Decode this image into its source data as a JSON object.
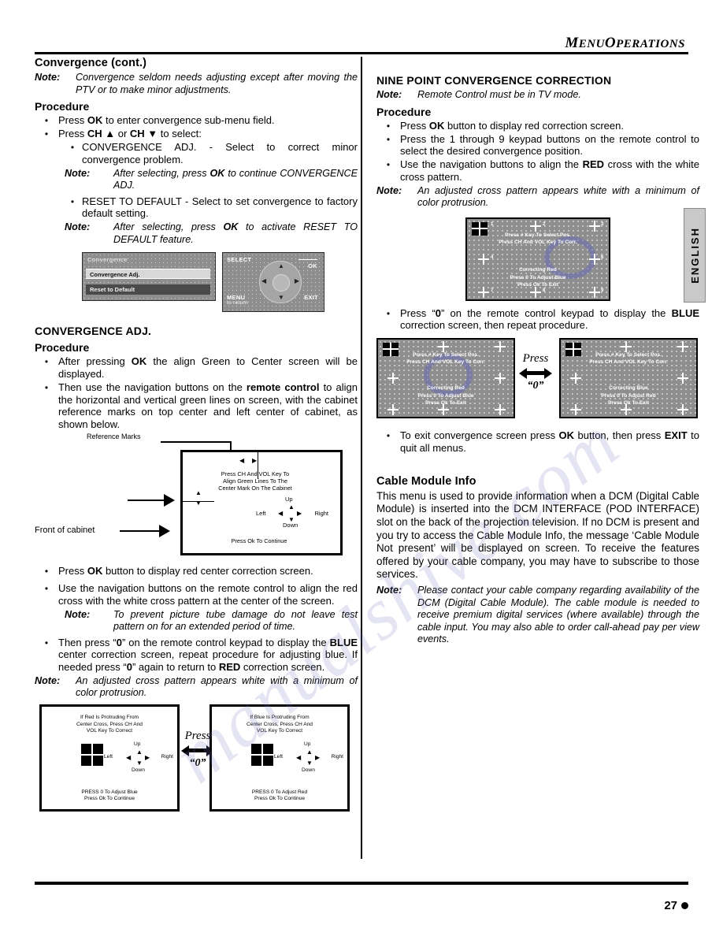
{
  "header": {
    "title_small": "ENU",
    "title_m1": "M",
    "title_m2": "O",
    "title_small2": "PERATIONS",
    "title_full": "MENU OPERATIONS"
  },
  "side_tab": {
    "label": "ENGLISH"
  },
  "footer": {
    "page_number": "27"
  },
  "left": {
    "heading": "Convergence (cont.)",
    "note1": {
      "label": "Note:",
      "text": "Convergence seldom needs adjusting except after moving the PTV or to make minor adjustments."
    },
    "procedure_label": "Procedure",
    "bullets": [
      {
        "pre": "Press ",
        "bold": "OK",
        "post": " to enter convergence  sub-menu field."
      },
      {
        "pre": "Press ",
        "bold": "CH ▲",
        "mid": " or ",
        "bold2": "CH ▼",
        "post": "  to select:"
      }
    ],
    "sub_bullet1": "CONVERGENCE ADJ. - Select to correct minor convergence problem.",
    "note2": {
      "label": "Note:",
      "text": "After selecting, press ",
      "bold": "OK",
      "text2": " to continue CONVERGENCE ADJ."
    },
    "sub_bullet2": "RESET TO DEFAULT - Select to set convergence to factory default setting.",
    "note3": {
      "label": "Note:",
      "text": "After selecting, press ",
      "bold": "OK",
      "text2": " to activate RESET TO DEFAULT feature."
    },
    "osd": {
      "title": "Convergence",
      "item_selected": "Convergence  Adj.",
      "item_second": "Reset to Default",
      "nav_select": "SELECT",
      "nav_ok": "OK",
      "nav_menu": "MENU",
      "nav_return": "to return",
      "nav_exit": "EXIT"
    },
    "heading2": "CONVERGENCE ADJ.",
    "procedure_label2": "Procedure",
    "bullets2": [
      {
        "pre": "After pressing ",
        "bold": "OK",
        "post": "  the align Green to Center screen will be displayed."
      },
      {
        "pre": "Then use the navigation buttons on the ",
        "bold": "remote control",
        "post": " to align the horizontal and vertical green lines on screen, with the cabinet reference marks on top center and left center of cabinet, as shown below."
      }
    ],
    "cabinet": {
      "label_reference": "Reference Marks",
      "label_front": "Front of cabinet",
      "instruction_line1": "Press CH And VOL Key To",
      "instruction_line2": "Align Green Lines To The",
      "instruction_line3": "Center Mark On The Cabinet",
      "continue": "Press Ok To Continue",
      "up": "Up",
      "down": "Down",
      "left": "Left",
      "right": "Right"
    },
    "bullets3": [
      {
        "pre": "Press ",
        "bold": "OK",
        "post": " button to display red center correction screen."
      },
      {
        "pre": "Use the navigation buttons on the remote control to align the red cross with the white cross pattern at the center of the screen.",
        "bold": "",
        "post": ""
      }
    ],
    "note4": {
      "label": "Note:",
      "text": "To prevent picture tube damage do not leave test pattern on for an extended period of time."
    },
    "bullet4": {
      "pre": "Then press “",
      "bold": "0",
      "mid": "” on the remote control keypad to display the ",
      "bold2": "BLUE",
      "mid2": " center correction screen, repeat procedure for adjusting blue. If needed press “",
      "bold3": "0",
      "mid3": "” again to return to ",
      "bold4": "RED",
      "post": " correction screen."
    },
    "note5": {
      "label": "Note:",
      "text": "An adjusted cross pattern appears white with a minimum of color protrusion."
    },
    "pair_left": {
      "top_line1": "If Red Is Protruding From",
      "top_line2": "Center Cross, Press CH And",
      "top_line3": "VOL Key To Correct",
      "bot_line1": "PRESS 0 To Adjust Blue",
      "bot_line2": "Press Ok To Continue",
      "up": "Up",
      "down": "Down",
      "left": "Left",
      "right": "Right"
    },
    "pair_right": {
      "top_line1": "If Blue Is Protruding From",
      "top_line2": "Center Cross, Press CH And",
      "top_line3": "VOL Key To Correct",
      "bot_line1": "PRESS 0 To Adjust Red",
      "bot_line2": "Press Ok To Continue",
      "up": "Up",
      "down": "Down",
      "left": "Left",
      "right": "Right"
    },
    "press_label": "Press",
    "press_zero": "“0”"
  },
  "right": {
    "heading": "NINE POINT CONVERGENCE CORRECTION",
    "note1": {
      "label": "Note:",
      "text": "Remote Control must be in TV mode."
    },
    "procedure_label": "Procedure",
    "bullets": [
      {
        "pre": "Press ",
        "bold": "OK",
        "post": " button to display red correction screen."
      },
      {
        "pre": "Press the 1 through 9 keypad buttons on the remote control to select the desired convergence position.",
        "bold": "",
        "post": ""
      },
      {
        "pre": "Use the navigation buttons to align the ",
        "bold": "RED",
        "post": " cross with the white cross pattern."
      }
    ],
    "note2": {
      "label": "Note:",
      "text": "An adjusted cross pattern appears white with a minimum of color protrusion."
    },
    "screen_red": {
      "line1": "Press # Key To Select Pos.",
      "line2": "Press CH And VOL Key To Corr.",
      "line3": "Correcting Red",
      "line4": "Press 0 To Adjust Blue",
      "line5": "Press Ok To Exit",
      "numbers": [
        "1",
        "2",
        "3",
        "4",
        "5",
        "6",
        "7",
        "8",
        "9"
      ]
    },
    "bullet_blue": {
      "pre": "Press “",
      "bold": "0",
      "mid": "” on the remote control keypad to display the ",
      "bold2": "BLUE",
      "post": " correction screen, then repeat procedure."
    },
    "screen_pair_left": {
      "line1": "Press # Key To Select Pos.",
      "line2": "Press CH And VOL Key To Corr.",
      "line3": "Correcting Red",
      "line4": "Press 0 To Adjust Blue",
      "line5": "Press Ok To Exit"
    },
    "screen_pair_right": {
      "line1": "Press # Key To Select Pos.",
      "line2": "Press CH And VOL Key To Corr.",
      "line3": "Correcting Blue",
      "line4": "Press 0 To Adjust Red",
      "line5": "Press Ok To Exit"
    },
    "press_label": "Press",
    "press_zero": "“0”",
    "bullet_exit": {
      "pre": "To exit convergence screen press ",
      "bold": "OK",
      "mid": " button, then press ",
      "bold2": "EXIT",
      "post": " to quit all menus."
    },
    "heading2": "Cable Module Info",
    "paragraph": "This menu is used to provide information when a DCM (Digital Cable Module) is inserted into the DCM INTERFACE (POD INTERFACE) slot on the back of the projection television. If no DCM is present and you try to access the Cable Module Info, the message ‘Cable Module Not present’ will be displayed on screen. To receive the features offered by your cable company, you may have to subscribe to those services.",
    "note3": {
      "label": "Note:",
      "text": "Please contact your cable company regarding availability of the DCM (Digital Cable Module). The cable module is needed to  receive premium digital services (where available)  through the cable input. You may also able to order call-ahead pay per view events."
    }
  },
  "watermark": {
    "line1": "manualshive.com",
    "line2": "manualshive"
  },
  "colors": {
    "osd_bg": "#8e8e8e",
    "tab_bg": "#c9c9c9",
    "ink": "#000000"
  }
}
